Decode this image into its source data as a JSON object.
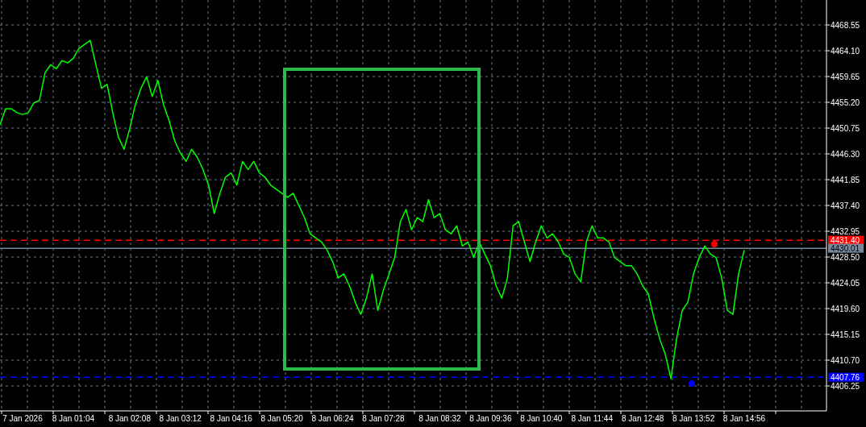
{
  "chart_data": {
    "type": "line",
    "categories": [
      null,
      null,
      null,
      null,
      "7 Jan 2026",
      null,
      null,
      null,
      null,
      null,
      null,
      null,
      null,
      "8 Jan 01:04",
      null,
      null,
      null,
      null,
      null,
      null,
      null,
      null,
      null,
      "8 Jan 02:08",
      null,
      null,
      null,
      null,
      null,
      null,
      null,
      null,
      "8 Jan 03:12",
      null,
      null,
      null,
      null,
      null,
      null,
      null,
      null,
      "8 Jan 04:16",
      null,
      null,
      null,
      null,
      null,
      null,
      null,
      null,
      "8 Jan 05:20",
      null,
      null,
      null,
      null,
      null,
      null,
      null,
      null,
      "8 Jan 06:24",
      null,
      null,
      null,
      null,
      null,
      null,
      null,
      null,
      "8 Jan 07:28",
      null,
      null,
      null,
      null,
      null,
      null,
      null,
      null,
      null,
      "8 Jan 08:32",
      null,
      null,
      null,
      null,
      null,
      null,
      null,
      null,
      "8 Jan 09:36",
      null,
      null,
      null,
      null,
      null,
      null,
      null,
      null,
      "8 Jan 10:40",
      null,
      null,
      null,
      null,
      null,
      null,
      null,
      null,
      "8 Jan 11:44",
      null,
      null,
      null,
      null,
      null,
      null,
      null,
      null,
      "8 Jan 12:48",
      null,
      null,
      null,
      null,
      null,
      null,
      null,
      null,
      "8 Jan 13:52",
      null,
      null,
      null,
      null,
      null,
      null,
      null,
      null,
      "8 Jan 14:56"
    ],
    "series": [
      {
        "color": "#00ff00",
        "values": [
          4451.3,
          4454.1,
          4454.1,
          4453.4,
          4453.1,
          4453.4,
          4455.1,
          4455.5,
          4460.3,
          4461.7,
          4461.0,
          4462.4,
          4462.0,
          4462.8,
          4464.5,
          4465.2,
          4465.9,
          4461.7,
          4457.6,
          4458.3,
          4453.4,
          4449.2,
          4447.1,
          4450.6,
          4454.8,
          4457.6,
          4459.6,
          4456.2,
          4459.0,
          4454.8,
          4452.0,
          4448.5,
          4446.4,
          4445.0,
          4447.1,
          4445.7,
          4443.6,
          4440.9,
          4436.0,
          4439.5,
          4442.3,
          4443.0,
          4440.9,
          4445.0,
          4443.6,
          4445.0,
          4443.0,
          4442.3,
          4440.9,
          4440.2,
          4439.5,
          4438.8,
          4439.5,
          4437.4,
          4435.3,
          4432.5,
          4431.8,
          4431.1,
          4429.7,
          4427.7,
          4424.9,
          4425.6,
          4423.5,
          4420.7,
          4418.6,
          4421.4,
          4425.6,
          4419.3,
          4422.8,
          4425.6,
          4428.4,
          4434.6,
          4436.7,
          4433.2,
          4435.3,
          4434.6,
          4438.4,
          4435.3,
          4436.0,
          4433.2,
          4432.5,
          4433.9,
          4430.4,
          4431.1,
          4428.4,
          4431.1,
          4429.0,
          4427.0,
          4423.5,
          4421.4,
          4424.9,
          4433.9,
          4434.6,
          4431.1,
          4427.7,
          4431.1,
          4433.9,
          4431.8,
          4432.5,
          4431.1,
          4429.0,
          4428.4,
          4425.6,
          4424.2,
          4431.1,
          4433.9,
          4431.8,
          4431.8,
          4431.1,
          4428.4,
          4427.7,
          4427.0,
          4427.0,
          4425.6,
          4423.5,
          4422.1,
          4417.9,
          4414.4,
          4411.7,
          4407.5,
          4414.4,
          4419.3,
          4420.7,
          4425.6,
          4428.4,
          4430.4,
          4429.0,
          4428.4,
          4424.9,
          4419.3,
          4418.6,
          4425.6,
          4429.7
        ]
      }
    ],
    "ylim": [
      4401.94,
      4472.86
    ],
    "grid": true,
    "ref_lines": [
      {
        "axis": "y",
        "value": 4431.4,
        "label": "4431.40",
        "color": "#ff0000"
      },
      {
        "axis": "y",
        "value": 4430.01,
        "label": "4430.01",
        "color": "#778899"
      },
      {
        "axis": "y",
        "value": 4407.76,
        "label": "4407.76",
        "color": "#0000ff"
      }
    ],
    "yticks": [
      {
        "value": 4468.55,
        "label": "4468.55"
      },
      {
        "value": 4464.1,
        "label": "4464.10"
      },
      {
        "value": 4459.65,
        "label": "4459.65"
      },
      {
        "value": 4455.2,
        "label": "4455.20"
      },
      {
        "value": 4450.75,
        "label": "4450.75"
      },
      {
        "value": 4446.3,
        "label": "4446.30"
      },
      {
        "value": 4441.85,
        "label": "4441.85"
      },
      {
        "value": 4437.4,
        "label": "4437.40"
      },
      {
        "value": 4432.95,
        "label": "4432.95"
      },
      {
        "value": 4428.5,
        "label": "4428.50"
      },
      {
        "value": 4424.05,
        "label": "4424.05"
      },
      {
        "value": 4419.6,
        "label": "4419.60"
      },
      {
        "value": 4415.15,
        "label": "4415.15"
      },
      {
        "value": 4410.7,
        "label": "4410.70"
      },
      {
        "value": 4406.25,
        "label": "4406.25"
      }
    ]
  }
}
